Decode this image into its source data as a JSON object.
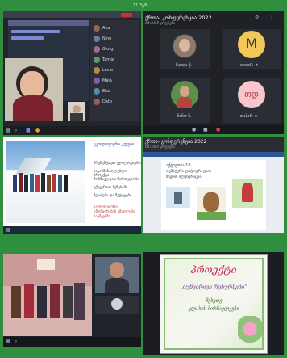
{
  "top_time": "71.3გ8",
  "panels": {
    "p1": {
      "participants": [
        "Ana",
        "Nino",
        "Giorgi",
        "Tamar",
        "Levan",
        "Maia",
        "Eka",
        "Dato"
      ]
    },
    "p2": {
      "title": "ქრთა- კონფერენცია 2022",
      "subtitle": "04:24   მ  ყოფნება",
      "names": [
        "ნათია ქ.",
        "ansel1 ★",
        "ნინო ნ.",
        "თამარ ★"
      ],
      "avatar_m": "M",
      "avatar_td": "თდ"
    },
    "p3": {
      "slide_title": "ეკოლოგიური კლუბი",
      "bullets": [
        "პრეზენტაცია ეკოლოგიური",
        "საგანმანათლებლო პროექტი",
        "მოსწავლეთა ჩართულობა",
        "ექსკურსია ბუნებაში",
        "შეჯამება და შედეგები"
      ],
      "red_text": "ეკოლოგიური ცნობიერების ამაღლება ბავშვებში"
    },
    "p4": {
      "title": "ქრთა- კონფერენცია 2022",
      "subtitle": "04:24   მ  ყოფნება",
      "card_lines": [
        "აქტივობა 10",
        "თემატური ფოტოგრაფიის",
        "წიგნის ილუსტრაცია"
      ]
    },
    "p6": {
      "heading": "პროექტი",
      "line1": "„ბუნებრივი რესურსები“",
      "line2": "მეხუთე",
      "line3": "კლასის მოსწავლეები"
    }
  }
}
